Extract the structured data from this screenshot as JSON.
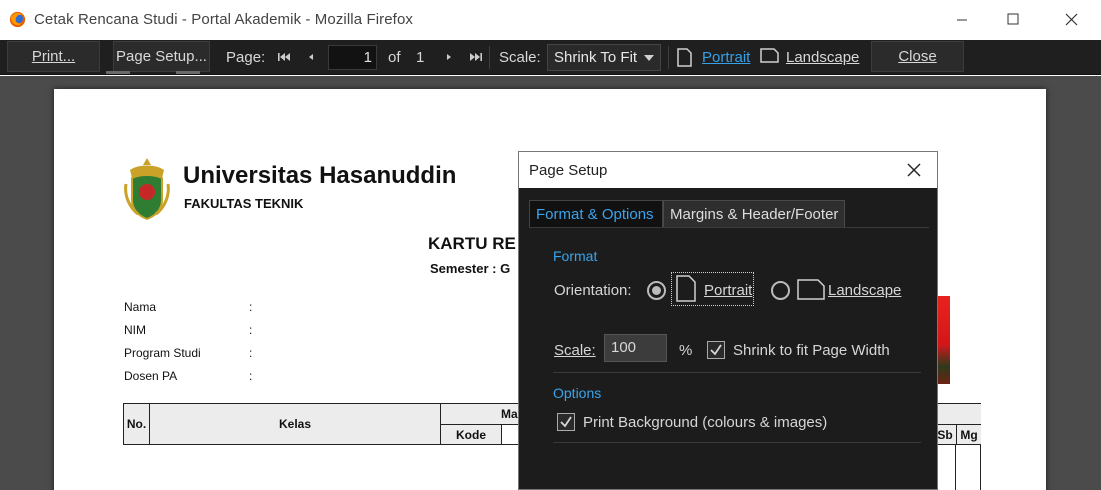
{
  "window": {
    "title": "Cetak Rencana Studi - Portal Akademik - Mozilla Firefox"
  },
  "toolbar": {
    "print_label": "Print...",
    "page_setup_label": "Page Setup...",
    "page_label": "Page:",
    "current_page": "1",
    "of_label": "of",
    "total_pages": "1",
    "scale_label": "Scale:",
    "scale_value": "Shrink To Fit",
    "portrait_label": "Portrait",
    "landscape_label": "Landscape",
    "close_label": "Close",
    "colors": {
      "background": "#1f1f1f",
      "accent": "#36a0e8"
    }
  },
  "document": {
    "university": "Universitas Hasanuddin",
    "faculty": "FAKULTAS TEKNIK",
    "title_visible": "KARTU RE",
    "semester_visible": "Semester : G",
    "fields": [
      {
        "label": "Nama",
        "sep": ":"
      },
      {
        "label": "NIM",
        "sep": ":"
      },
      {
        "label": "Program Studi",
        "sep": ":"
      },
      {
        "label": "Dosen PA",
        "sep": ":"
      }
    ],
    "table": {
      "no": "No.",
      "kelas": "Kelas",
      "ma_partial": "Ma",
      "kode": "Kode",
      "sb": "Sb",
      "mg": "Mg"
    }
  },
  "dialog": {
    "title": "Page Setup",
    "tabs": [
      "Format & Options",
      "Margins & Header/Footer"
    ],
    "active_tab": "Format & Options",
    "format_section": "Format",
    "orientation_label": "Orientation:",
    "portrait_label": "Portrait",
    "landscape_label": "Landscape",
    "orientation_selected": "Portrait",
    "scale_label": "Scale:",
    "scale_value": "100",
    "percent": "%",
    "shrink_label": "Shrink to fit Page Width",
    "shrink_checked": true,
    "options_section": "Options",
    "print_bg_label": "Print Background (colours & images)",
    "print_bg_checked": true
  }
}
